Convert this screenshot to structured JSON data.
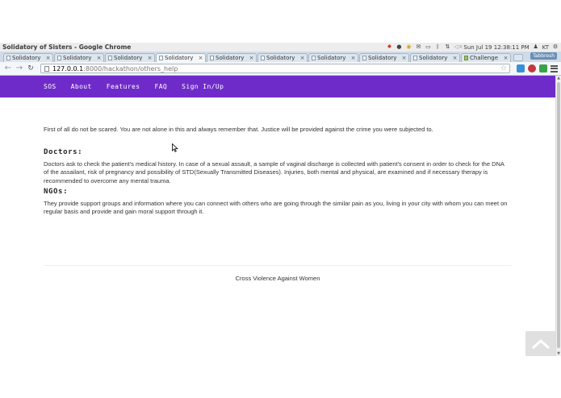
{
  "window": {
    "title": "Solidatory of Sisters - Google Chrome"
  },
  "system_tray": {
    "datetime": "Sun Jul 19 12:38:11 PM",
    "user": "KT",
    "icons": [
      "bug-icon",
      "skype-icon",
      "chrome-icon",
      "mail-icon",
      "battery-icon",
      "bluetooth-icon",
      "network-icon",
      "volume-muted-icon",
      "gear-icon"
    ]
  },
  "tabs": [
    {
      "label": "Solidatory",
      "active": false
    },
    {
      "label": "Solidatory",
      "active": false
    },
    {
      "label": "Solidatory",
      "active": false
    },
    {
      "label": "Solidatory",
      "active": true
    },
    {
      "label": "Solidatory",
      "active": false
    },
    {
      "label": "Solidatory",
      "active": false
    },
    {
      "label": "Solidatory",
      "active": false
    },
    {
      "label": "Solidatory",
      "active": false
    },
    {
      "label": "Solidatory",
      "active": false
    },
    {
      "label": "Challenge",
      "active": false
    }
  ],
  "tab_close_glyph": "×",
  "tab_strip_badge": "Tabbresh",
  "address_bar": {
    "host": "127.0.0.1",
    "path": ":8000/hackathon/others_help"
  },
  "site_nav": {
    "items": [
      "SOS",
      "About",
      "Features",
      "FAQ",
      "Sign In/Up"
    ]
  },
  "content": {
    "intro": "First of all do not be scared. You are not alone in this and always remember that. Justice will be provided against the crime you were subjected to.",
    "sections": [
      {
        "heading": "Doctors:",
        "text": "Doctors ask to check the patient's medical history. In case of a sexual assault, a sample of vaginal discharge is collected with patient's consent in order to check for the DNA of the assailant, risk of pregnancy and possibility of STD(Sexually Transmitted Diseases). Injuries, both mental and physical, are examined and if necessary therapy is recommended to overcome any mental trauma."
      },
      {
        "heading": "NGOs:",
        "text": "They provide support groups and information where you can connect with others who are going through the similar pain as you, living in your city with whom you can meet on regular basis and provide and gain moral support through it."
      }
    ]
  },
  "footer": {
    "text": "Cross Violence Against Women"
  },
  "colors": {
    "navbar": "#6f2bc9",
    "tabstrip": "#cfdbe7",
    "back_to_top": "#e0e0e0"
  }
}
